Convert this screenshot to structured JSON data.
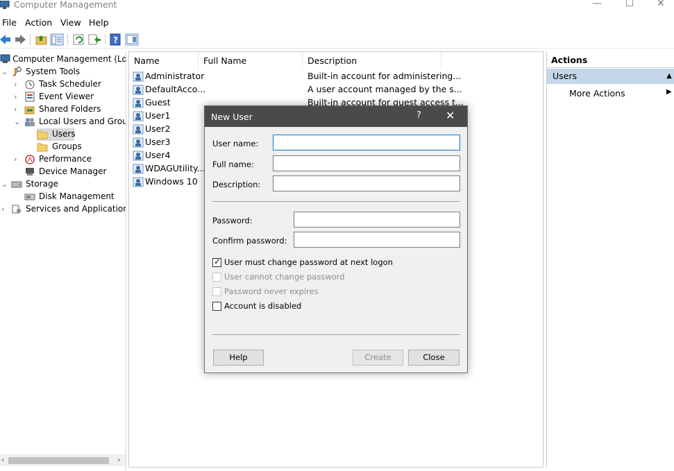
{
  "window": {
    "title": "Computer Management",
    "minimize": "—",
    "maximize": "☐",
    "close": "✕"
  },
  "menu": [
    "File",
    "Action",
    "View",
    "Help"
  ],
  "tree": {
    "root": "Computer Management (Local",
    "system_tools": "System Tools",
    "task_scheduler": "Task Scheduler",
    "event_viewer": "Event Viewer",
    "shared_folders": "Shared Folders",
    "local_users_groups": "Local Users and Groups",
    "users": "Users",
    "groups": "Groups",
    "performance": "Performance",
    "device_manager": "Device Manager",
    "storage": "Storage",
    "disk_management": "Disk Management",
    "services_apps": "Services and Applications"
  },
  "list": {
    "columns": [
      "Name",
      "Full Name",
      "Description"
    ],
    "rows": [
      {
        "name": "Administrator",
        "full_name": "",
        "description": "Built-in account for administering..."
      },
      {
        "name": "DefaultAcco...",
        "full_name": "",
        "description": "A user account managed by the s..."
      },
      {
        "name": "Guest",
        "full_name": "",
        "description": "Built-in account for guest access t..."
      },
      {
        "name": "User1",
        "full_name": "",
        "description": ""
      },
      {
        "name": "User2",
        "full_name": "",
        "description": ""
      },
      {
        "name": "User3",
        "full_name": "",
        "description": ""
      },
      {
        "name": "User4",
        "full_name": "",
        "description": ""
      },
      {
        "name": "WDAGUtility...",
        "full_name": "",
        "description": ""
      },
      {
        "name": "Windows 10",
        "full_name": "",
        "description": ""
      }
    ]
  },
  "actions": {
    "header": "Actions",
    "section": "Users",
    "more": "More Actions"
  },
  "dialog": {
    "title": "New User",
    "help_glyph": "?",
    "close_glyph": "✕",
    "user_name_label": "User name:",
    "full_name_label": "Full name:",
    "description_label": "Description:",
    "password_label": "Password:",
    "confirm_label": "Confirm password:",
    "user_name_value": "",
    "full_name_value": "",
    "description_value": "",
    "password_value": "",
    "confirm_value": "",
    "checks": {
      "must_change": {
        "label": "User must change password at next logon",
        "checked": true,
        "enabled": true
      },
      "cannot_change": {
        "label": "User cannot change password",
        "checked": false,
        "enabled": false
      },
      "never_expires": {
        "label": "Password never expires",
        "checked": false,
        "enabled": false
      },
      "disabled": {
        "label": "Account is disabled",
        "checked": false,
        "enabled": true
      }
    },
    "help_button": "Help",
    "create_button": "Create",
    "close_button": "Close"
  },
  "colors": {
    "dialog_title_bg": "#4a4a4a",
    "selection_bg": "#c5d6e8",
    "focus_border": "#0078d7"
  }
}
